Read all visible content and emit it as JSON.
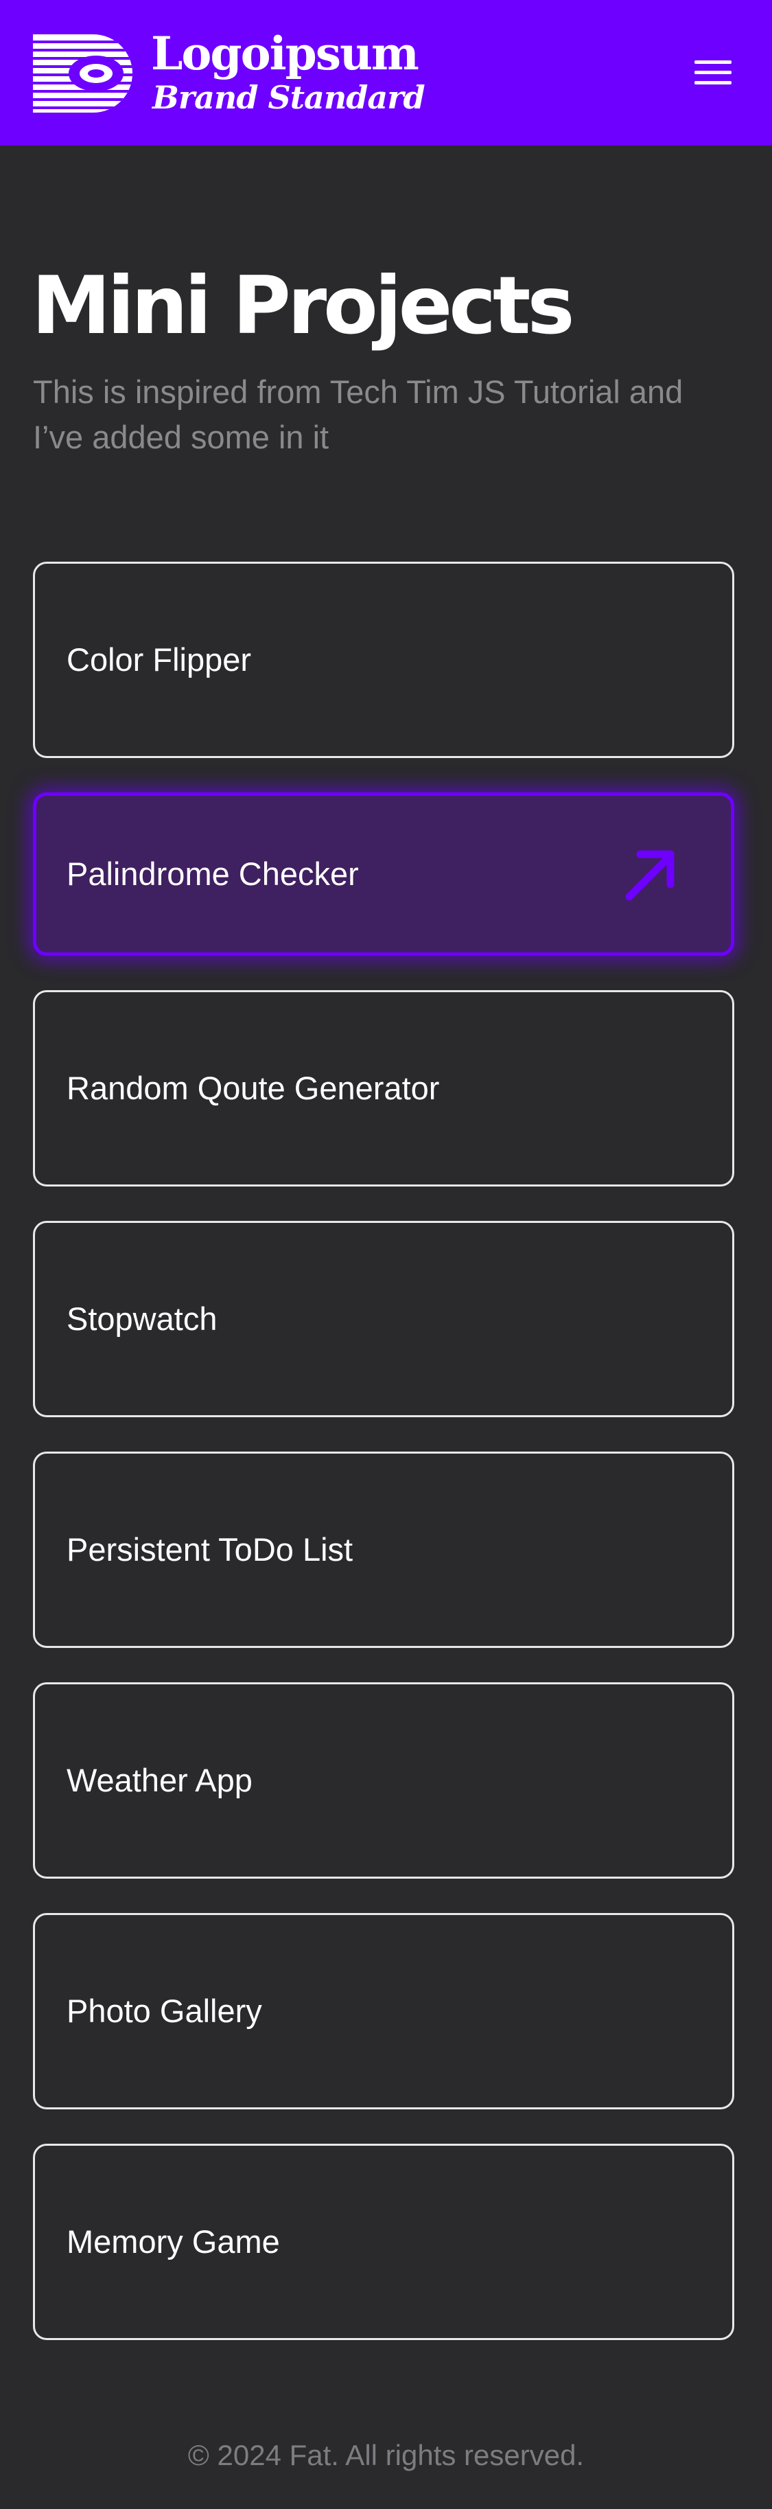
{
  "header": {
    "brand_name": "Logoipsum",
    "brand_tagline": "Brand Standard",
    "logo_icon": "striped-circle-logo-icon",
    "menu_icon": "hamburger-menu-icon",
    "background_color": "#6e00ff"
  },
  "main": {
    "title": "Mini Projects",
    "subtitle": "This is inspired from Tech Tim JS Tutorial and I’ve added some in it",
    "projects": [
      {
        "label": "Color Flipper"
      },
      {
        "label": "Palindrome Checker",
        "state": "hover",
        "icon": "arrow-up-right-icon"
      },
      {
        "label": "Random Qoute Generator"
      },
      {
        "label": "Stopwatch"
      },
      {
        "label": "Persistent ToDo List"
      },
      {
        "label": "Weather App"
      },
      {
        "label": "Photo Gallery"
      },
      {
        "label": "Memory Game"
      }
    ]
  },
  "footer": {
    "copyright": "© 2024 Fat. All rights reserved."
  },
  "colors": {
    "accent": "#6e00ff",
    "page_background": "#2a292c",
    "active_card_background": "#3f2060",
    "muted_text": "#8a898d"
  }
}
